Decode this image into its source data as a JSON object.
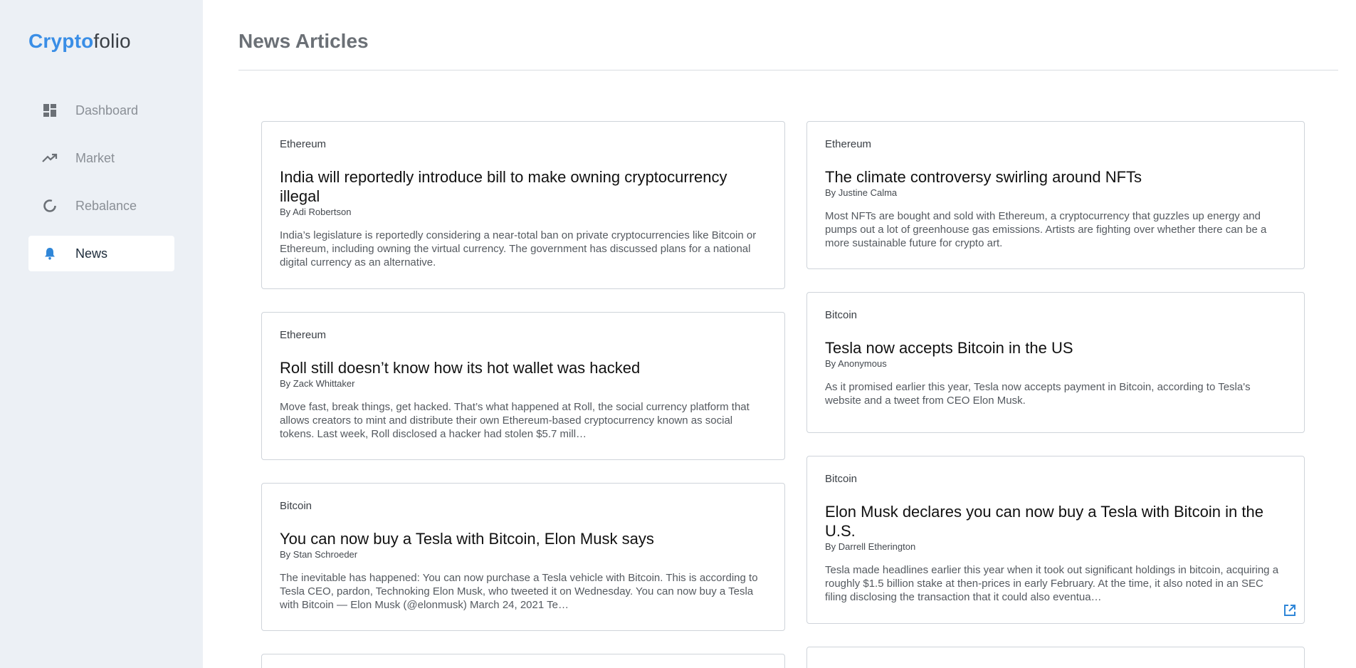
{
  "app": {
    "logo_part1": "Crypto",
    "logo_part2": "folio"
  },
  "sidebar": {
    "items": [
      {
        "label": "Dashboard",
        "icon": "dashboard-icon"
      },
      {
        "label": "Market",
        "icon": "trending-up-icon"
      },
      {
        "label": "Rebalance",
        "icon": "donut-icon"
      },
      {
        "label": "News",
        "icon": "bell-icon",
        "active": true
      }
    ]
  },
  "page": {
    "title": "News Articles"
  },
  "articles_left": [
    {
      "tag": "Ethereum",
      "title": "India will reportedly introduce bill to make owning cryptocurrency illegal",
      "byline": "By Adi Robertson",
      "summary": "India’s legislature is reportedly considering a near-total ban on private cryptocurrencies like Bitcoin or Ethereum, including owning the virtual currency. The government has discussed plans for a national digital currency as an alternative."
    },
    {
      "tag": "Ethereum",
      "title": "Roll still doesn’t know how its hot wallet was hacked",
      "byline": "By Zack Whittaker",
      "summary": "Move fast, break things, get hacked. That’s what happened at Roll, the social currency platform that allows creators to mint and distribute their own Ethereum-based cryptocurrency known as social tokens. Last week, Roll disclosed a hacker had stolen $5.7 mill…"
    },
    {
      "tag": "Bitcoin",
      "title": "You can now buy a Tesla with Bitcoin, Elon Musk says",
      "byline": "By Stan Schroeder",
      "summary": "The inevitable has happened: You can now purchase a Tesla vehicle with Bitcoin.  This is according to Tesla CEO, pardon, Technoking Elon Musk, who tweeted it on Wednesday.  You can now buy a Tesla with Bitcoin — Elon Musk (@elonmusk) March 24, 2021 Te…"
    }
  ],
  "articles_right": [
    {
      "tag": "Ethereum",
      "title": "The climate controversy swirling around NFTs",
      "byline": "By Justine Calma",
      "summary": "Most NFTs are bought and sold with Ethereum, a cryptocurrency that guzzles up energy and pumps out a lot of greenhouse gas emissions. Artists are fighting over whether there can be a more sustainable future for crypto art."
    },
    {
      "tag": "Bitcoin",
      "title": "Tesla now accepts Bitcoin in the US",
      "byline": "By Anonymous",
      "summary": "As it promised earlier this year, Tesla now accepts payment in Bitcoin, according to Tesla's website and a tweet from CEO Elon Musk."
    },
    {
      "tag": "Bitcoin",
      "title": "Elon Musk declares you can now buy a Tesla with Bitcoin in the U.S.",
      "byline": "By Darrell Etherington",
      "summary": "Tesla made headlines earlier this year when it took out significant holdings in bitcoin, acquiring a roughly $1.5 billion stake at then-prices in early February. At the time, it also noted in an SEC filing disclosing the transaction that it could also eventua…",
      "external_link_icon": "external-link-icon"
    }
  ],
  "colors": {
    "sidebar_bg": "#ecf0f5",
    "brand_blue": "#3a8ee6",
    "active_icon_blue": "#2f86d8"
  }
}
